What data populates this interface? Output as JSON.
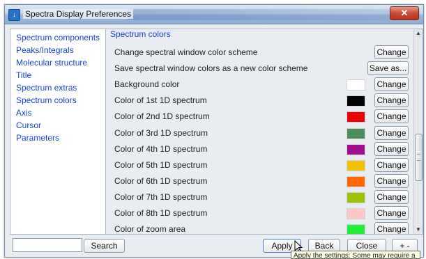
{
  "window": {
    "title": "Spectra Display Preferences",
    "close_label": "✕",
    "title_icon": "app-icon"
  },
  "sidebar": {
    "items": [
      {
        "label": "Spectrum components"
      },
      {
        "label": "Peaks/Integrals"
      },
      {
        "label": "Molecular structure"
      },
      {
        "label": "Title"
      },
      {
        "label": "Spectrum extras"
      },
      {
        "label": "Spectrum colors"
      },
      {
        "label": "Axis"
      },
      {
        "label": "Cursor"
      },
      {
        "label": "Parameters"
      }
    ]
  },
  "main": {
    "section_title": "Spectrum colors",
    "rows": [
      {
        "label": "Change spectral window color scheme",
        "button": "Change",
        "color": null
      },
      {
        "label": "Save spectral window colors as a new color scheme",
        "button": "Save as...",
        "color": null
      },
      {
        "label": "Background color",
        "button": "Change",
        "color": "#ffffff"
      },
      {
        "label": "Color of 1st 1D spectrum",
        "button": "Change",
        "color": "#000000"
      },
      {
        "label": "Color of 2nd 1D spectrum",
        "button": "Change",
        "color": "#ee0000"
      },
      {
        "label": "Color of 3rd 1D spectrum",
        "button": "Change",
        "color": "#4f8a5a"
      },
      {
        "label": "Color of 4th 1D spectrum",
        "button": "Change",
        "color": "#a0108a"
      },
      {
        "label": "Color of 5th 1D spectrum",
        "button": "Change",
        "color": "#f2c200"
      },
      {
        "label": "Color of 6th 1D spectrum",
        "button": "Change",
        "color": "#ff6a00"
      },
      {
        "label": "Color of 7th 1D spectrum",
        "button": "Change",
        "color": "#9dc400"
      },
      {
        "label": "Color of 8th 1D spectrum",
        "button": "Change",
        "color": "#ffc8c8"
      },
      {
        "label": "Color of zoom area",
        "button": "Change",
        "color": "#22ee33"
      }
    ]
  },
  "footer": {
    "search_value": "",
    "search_label": "Search",
    "apply_label": "Apply",
    "back_label": "Back",
    "close_label": "Close",
    "plusminus_label": "+ -"
  },
  "tooltip": {
    "text": "Apply the settings: Some may require a"
  }
}
